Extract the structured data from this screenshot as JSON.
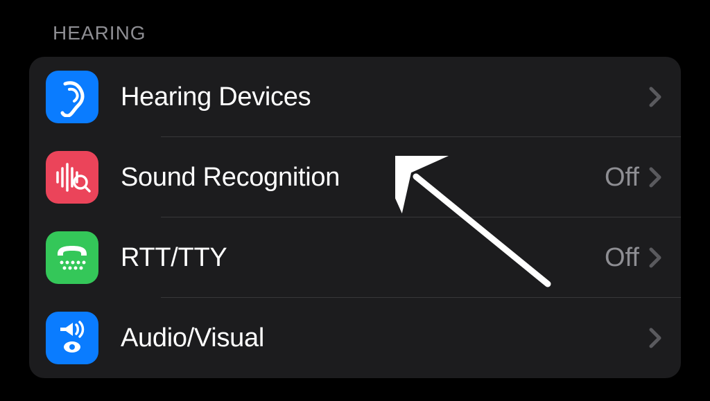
{
  "section": {
    "header": "HEARING",
    "items": [
      {
        "label": "Hearing Devices",
        "value": ""
      },
      {
        "label": "Sound Recognition",
        "value": "Off"
      },
      {
        "label": "RTT/TTY",
        "value": "Off"
      },
      {
        "label": "Audio/Visual",
        "value": ""
      }
    ]
  }
}
